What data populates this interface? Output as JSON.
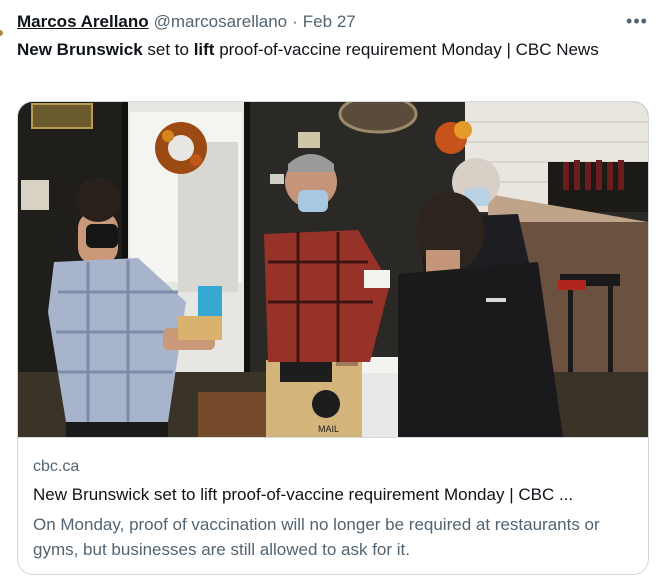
{
  "tweet": {
    "author_name": "Marcos Arellano",
    "author_handle": "@marcosarellano",
    "separator": "·",
    "date": "Feb 27",
    "more_label": "•••",
    "text_part1": "New Brunswick",
    "text_part2": " set to ",
    "text_part3": "lift",
    "text_part4": " proof-of-vaccine requirement Monday | CBC News"
  },
  "card": {
    "image_alt": "Restaurant staff checking customers' proof of vaccination at a host stand",
    "mail_sign": "MAIL",
    "domain": "cbc.ca",
    "title": "New Brunswick set to lift proof-of-vaccine requirement Monday | CBC ...",
    "description": "On Monday, proof of vaccination will no longer be required at restaurants or gyms, but businesses are still allowed to ask for it."
  },
  "colors": {
    "text_primary": "#0f1419",
    "text_secondary": "#536471",
    "border": "#cfd9de"
  },
  "icons": {
    "more": "more-horizontal-icon"
  }
}
